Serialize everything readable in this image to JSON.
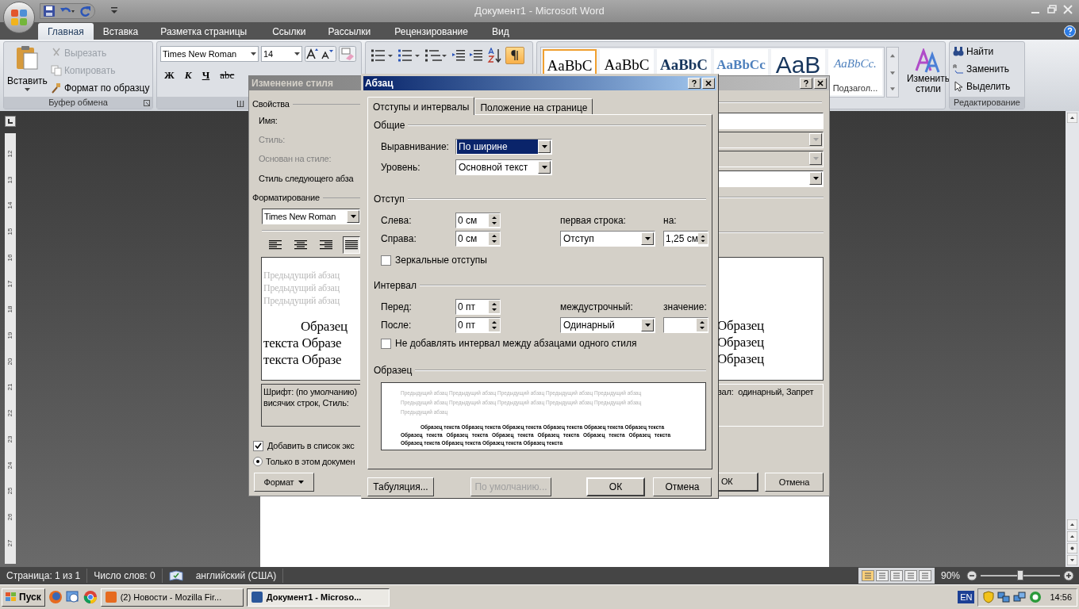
{
  "window": {
    "title": "Документ1 - Microsoft Word"
  },
  "ribbon_tabs": [
    {
      "label": "Главная",
      "selected": true
    },
    {
      "label": "Вставка",
      "selected": false
    },
    {
      "label": "Разметка страницы",
      "selected": false
    },
    {
      "label": "Ссылки",
      "selected": false
    },
    {
      "label": "Рассылки",
      "selected": false
    },
    {
      "label": "Рецензирование",
      "selected": false
    },
    {
      "label": "Вид",
      "selected": false
    }
  ],
  "clipboard": {
    "paste": "Вставить",
    "items": [
      {
        "label": "Вырезать",
        "disabled": true
      },
      {
        "label": "Копировать",
        "disabled": true
      },
      {
        "label": "Формат по образцу",
        "disabled": false
      }
    ],
    "group_label": "Буфер обмена"
  },
  "font": {
    "family": "Times New Roman",
    "size": "14",
    "group_label": "Ш",
    "format_buttons": [
      "Ж",
      "К",
      "Ч",
      "abc"
    ]
  },
  "paragraph": {
    "show_marks": true
  },
  "styles": {
    "items": [
      {
        "preview": "AaBbC",
        "kind": "normal",
        "selected": true
      },
      {
        "preview": "AaBbC",
        "kind": "normal",
        "selected": false
      },
      {
        "preview": "AaBbC",
        "kind": "heading",
        "selected": false
      },
      {
        "preview": "AaBbCc",
        "kind": "subheading",
        "selected": false
      },
      {
        "preview": "AaB",
        "kind": "title",
        "selected": false
      },
      {
        "preview": "AaBbCc.",
        "kind": "subtitle",
        "caption": "Подзагол...",
        "selected": false
      }
    ],
    "change_styles": "Изменить стили"
  },
  "editing": {
    "items": [
      "Найти",
      "Заменить",
      "Выделить"
    ],
    "group_label": "Редактирование"
  },
  "ruler_marks": [
    "12",
    "13",
    "14",
    "15",
    "16",
    "17",
    "18",
    "19",
    "20",
    "21",
    "22",
    "23",
    "24",
    "25",
    "26",
    "27"
  ],
  "style_dialog": {
    "title": "Изменение стиля",
    "properties_heading": "Свойства",
    "fields": [
      {
        "label": "Имя:",
        "kind": "text",
        "disabled": false
      },
      {
        "label": "Стиль:",
        "kind": "select",
        "disabled": true
      },
      {
        "label": "Основан на стиле:",
        "kind": "select",
        "disabled": true
      },
      {
        "label": "Стиль следующего абза",
        "kind": "select",
        "disabled": false
      }
    ],
    "formatting_heading": "Форматирование",
    "font": "Times New Roman",
    "alignment": [
      {
        "selected": false
      },
      {
        "selected": false
      },
      {
        "selected": false
      },
      {
        "selected": true
      }
    ],
    "preview_previous": [
      "Предыдущий абзац",
      "Предыдущий абзац",
      "Предыдущий абзац"
    ],
    "preview_sample_left": [
      "Образец",
      "текста Образе",
      "текста Образе"
    ],
    "preview_sample_right": [
      "Образец",
      "Образец",
      "Образец"
    ],
    "description_left": [
      "Шрифт: (по умолчанию)",
      "висячих строк, Стиль:"
    ],
    "description_right": [
      "вал:  одинарный, Запрет"
    ],
    "add_to_gallery": {
      "label": "Добавить в список экс",
      "checked": true
    },
    "only_document": {
      "label": "Только в этом докумен",
      "selected": true
    },
    "format_button": "Формат",
    "buttons": [
      "ОК",
      "Отмена"
    ]
  },
  "paragraph_dialog": {
    "title": "Абзац",
    "tabs": [
      {
        "label": "Отступы и интервалы",
        "selected": true
      },
      {
        "label": "Положение на странице",
        "selected": false
      }
    ],
    "general": {
      "heading": "Общие",
      "alignment": {
        "label": "Выравнивание:",
        "value": "По ширине"
      },
      "level": {
        "label": "Уровень:",
        "value": "Основной текст"
      }
    },
    "indent": {
      "heading": "Отступ",
      "left": {
        "label": "Слева:",
        "value": "0 см"
      },
      "right": {
        "label": "Справа:",
        "value": "0 см"
      },
      "first_line": {
        "label": "первая строка:",
        "value": "Отступ"
      },
      "by": {
        "label": "на:",
        "value": "1,25 см"
      },
      "mirror": {
        "label": "Зеркальные отступы",
        "checked": false
      }
    },
    "spacing": {
      "heading": "Интервал",
      "before": {
        "label": "Перед:",
        "value": "0 пт"
      },
      "after": {
        "label": "После:",
        "value": "0 пт"
      },
      "line": {
        "label": "междустрочный:",
        "value": "Одинарный"
      },
      "at": {
        "label": "значение:"
      },
      "no_space": {
        "label": "Не добавлять интервал между абзацами одного стиля",
        "checked": false
      }
    },
    "preview": {
      "heading": "Образец",
      "previous": [
        "Предыдущий абзац Предыдущий абзац Предыдущий абзац Предыдущий абзац Предыдущий абзац",
        "Предыдущий абзац Предыдущий абзац Предыдущий абзац Предыдущий абзац Предыдущий абзац",
        "Предыдущий абзац"
      ],
      "sample": [
        "Образец текста Образец текста Образец текста Образец текста Образец текста Образец текста",
        "Образец текста Образец текста Образец текста Образец текста Образец текста Образец текста",
        "Образец текста Образец текста Образец текста Образец текста"
      ]
    },
    "buttons": [
      {
        "label": "Табуляция...",
        "kind": "left",
        "disabled": false
      },
      {
        "label": "По умолчанию...",
        "kind": "left",
        "disabled": true
      },
      {
        "label": "ОК",
        "kind": "default",
        "disabled": false
      },
      {
        "label": "Отмена",
        "kind": "normal",
        "disabled": false
      }
    ]
  },
  "status_bar": {
    "page": "Страница: 1 из 1",
    "words": "Число слов: 0",
    "language": "английский (США)",
    "zoom": "90%",
    "zoom_level": {
      "level": 0.5
    }
  },
  "taskbar": {
    "start": "Пуск",
    "windows": [
      {
        "label": "(2) Новости - Mozilla Fir...",
        "selected": false
      },
      {
        "label": "Документ1 - Microso...",
        "selected": true
      }
    ],
    "language": "EN",
    "clock": "14:56"
  }
}
